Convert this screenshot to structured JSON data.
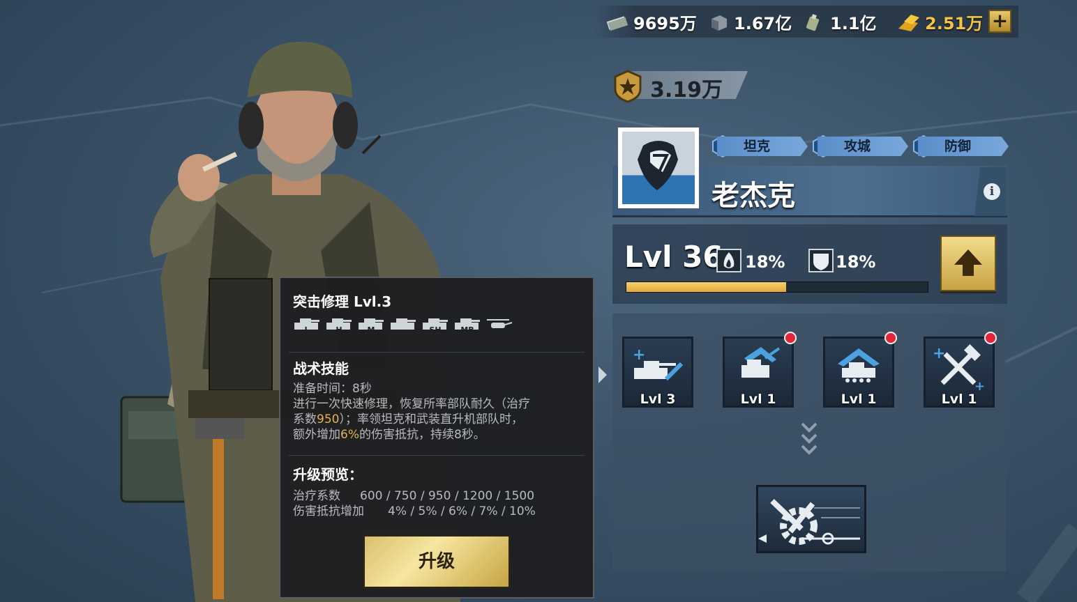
{
  "resources": {
    "cash": "9695万",
    "steel": "1.67亿",
    "oil": "1.1亿",
    "gold": "2.51万",
    "add_label": "+"
  },
  "power": "3.19万",
  "hero": {
    "name": "老杰克",
    "tags": [
      "坦克",
      "攻城",
      "防御"
    ],
    "info_label": "i",
    "level_text": "Lvl 36",
    "attack_bonus": "18%",
    "defense_bonus": "18%",
    "exp_progress": 0.53
  },
  "skills": [
    {
      "level": "Lvl 3",
      "has_dot": false
    },
    {
      "level": "Lvl 1",
      "has_dot": true
    },
    {
      "level": "Lvl 1",
      "has_dot": true
    },
    {
      "level": "Lvl 1",
      "has_dot": true
    }
  ],
  "tooltip": {
    "title": "突击修理 Lvl.3",
    "unit_types": [
      "L",
      "H",
      "M",
      "",
      "SH",
      "MB",
      ""
    ],
    "section1": "战术技能",
    "prep_time": "准备时间：8秒",
    "desc_line1": "进行一次快速修理，恢复所率部队耐久（治疗",
    "desc_line2_a": "系数",
    "desc_line2_hl": "950",
    "desc_line2_b": "）；率领坦克和武装直升机部队时，",
    "desc_line3_a": "额外增加",
    "desc_line3_hl": "6%",
    "desc_line3_b": "的伤害抵抗，持续8秒。",
    "section2": "升级预览：",
    "preview_row1_label": "治疗系数",
    "preview_row1_values": "600 / 750 / 950 / 1200 / 1500",
    "preview_row2_label": "伤害抵抗增加",
    "preview_row2_values": "4% / 5% / 6% / 7% / 10%",
    "upgrade_label": "升级"
  },
  "colors": {
    "gold": "#f4c542",
    "exp_bar": "#f2c15a",
    "tag_blue": "#6a9cd4",
    "red_dot": "#e6253a",
    "highlight": "#e2b44c"
  }
}
